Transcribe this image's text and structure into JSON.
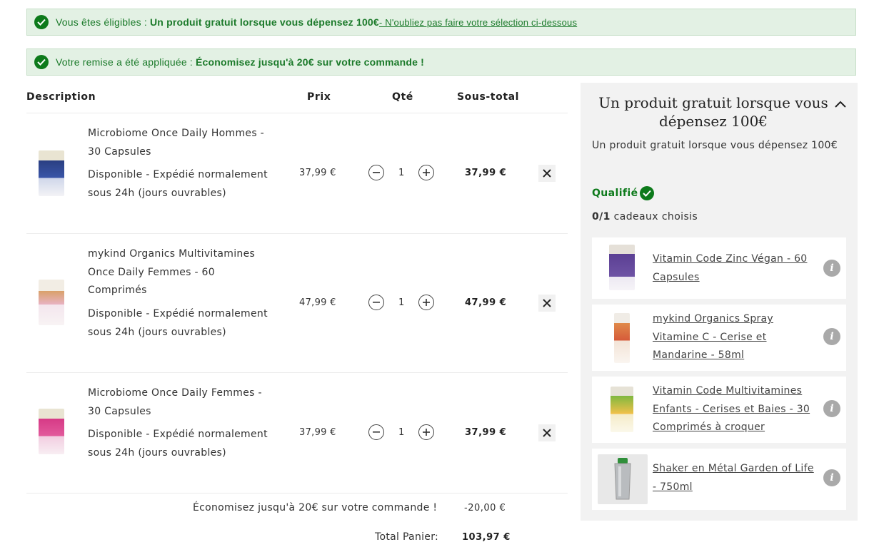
{
  "banners": [
    {
      "prefix": "Vous êtes éligibles :",
      "strong": "Un produit gratuit lorsque vous dépensez 100€",
      "link": " - N'oubliez pas faire votre sélection ci-dessous"
    },
    {
      "prefix": "Votre remise a été appliquée :",
      "strong": "Économisez jusqu'à 20€ sur votre commande !"
    }
  ],
  "table": {
    "headers": {
      "description": "Description",
      "price": "Prix",
      "qty": "Qté",
      "subtotal": "Sous-total"
    },
    "items": [
      {
        "name": "Microbiome Once Daily Hommes - 30 Capsules",
        "availability": "Disponible  -  Expédié normalement sous 24h (jours ouvrables)",
        "price": "37,99 €",
        "qty": "1",
        "subtotal": "37,99 €"
      },
      {
        "name": "mykind Organics Multivitamines Once Daily Femmes - 60 Comprimés",
        "availability": "Disponible  -  Expédié normalement sous 24h (jours ouvrables)",
        "price": "47,99 €",
        "qty": "1",
        "subtotal": "47,99 €"
      },
      {
        "name": "Microbiome Once Daily Femmes - 30 Capsules",
        "availability": "Disponible  -  Expédié normalement sous 24h (jours ouvrables)",
        "price": "37,99 €",
        "qty": "1",
        "subtotal": "37,99 €"
      }
    ]
  },
  "summary": {
    "discount_label": "Économisez jusqu'à 20€ sur votre commande !",
    "discount_value": "-20,00 €",
    "total_label": "Total Panier:",
    "total_value": "103,97 €"
  },
  "gift_panel": {
    "title": "Un produit gratuit lorsque vous dépensez 100€",
    "subtitle": "Un produit gratuit lorsque vous dépensez 100€",
    "qualified": "Qualifié",
    "chosen_count": "0/1",
    "chosen_label": "cadeaux choisis",
    "gifts": [
      {
        "name": "Vitamin Code Zinc Végan - 60 Capsules"
      },
      {
        "name": "mykind Organics Spray Vitamine C - Cerise et Mandarine - 58ml"
      },
      {
        "name": "Vitamin Code Multivitamines Enfants - Cerises et Baies - 30 Comprimés à croquer"
      },
      {
        "name": "Shaker en Métal Garden of Life - 750ml"
      }
    ]
  },
  "colors": {
    "success_green": "#0d7a1b",
    "banner_bg": "#e3f1e4",
    "panel_bg": "#f2f2f2"
  }
}
